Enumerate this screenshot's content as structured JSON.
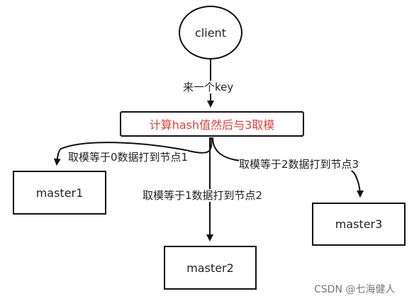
{
  "diagram": {
    "nodes": {
      "client": "client",
      "hash": "计算hash值然后与3取模",
      "master1": "master1",
      "master2": "master2",
      "master3": "master3"
    },
    "edges": {
      "client_to_hash": "来一个key",
      "to_node1": "取模等于0数据打到节点1",
      "to_node2": "取模等于1数据打到节点2",
      "to_node3": "取模等于2数据打到节点3"
    },
    "colors": {
      "hash_text": "#e0413a",
      "stroke": "#111111"
    }
  },
  "watermark": "CSDN @七海健人"
}
